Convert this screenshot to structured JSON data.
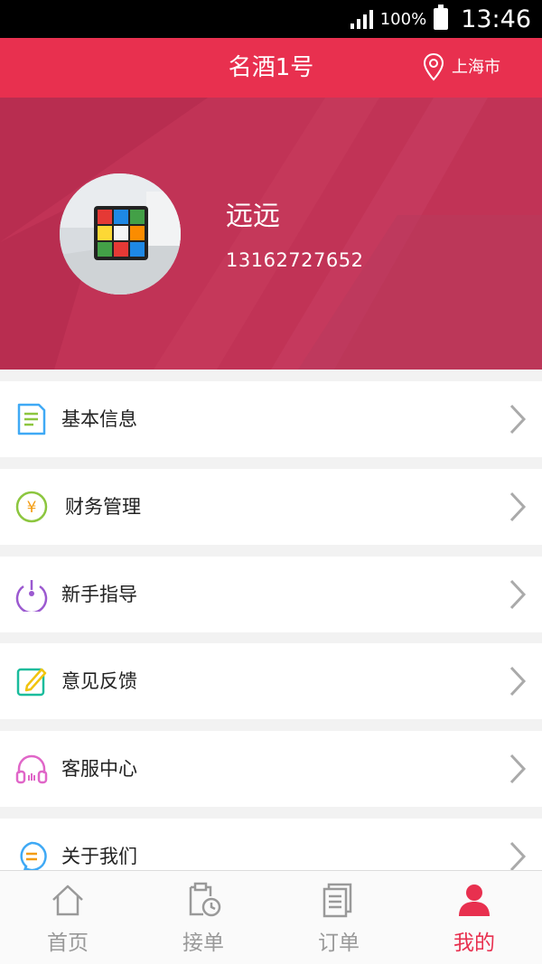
{
  "status_bar": {
    "battery": "100%",
    "time": "13:46"
  },
  "app_bar": {
    "title": "名酒1号",
    "city": "上海市"
  },
  "profile": {
    "name": "远远",
    "phone": "13162727652"
  },
  "menu": [
    {
      "label": "基本信息",
      "icon": "document-icon",
      "color": "#3fa9f5"
    },
    {
      "label": "财务管理",
      "icon": "yen-icon",
      "color": "#8cc63f"
    },
    {
      "label": "新手指导",
      "icon": "mouse-icon",
      "color": "#9b59d0"
    },
    {
      "label": "意见反馈",
      "icon": "edit-icon",
      "color": "#1abc9c"
    },
    {
      "label": "客服中心",
      "icon": "headphones-icon",
      "color": "#e066c8"
    },
    {
      "label": "关于我们",
      "icon": "chat-bubble-icon",
      "color": "#3fa9f5"
    }
  ],
  "bottom_nav": [
    {
      "label": "首页",
      "icon": "home-icon",
      "active": false
    },
    {
      "label": "接单",
      "icon": "clipboard-clock-icon",
      "active": false
    },
    {
      "label": "订单",
      "icon": "orders-icon",
      "active": false
    },
    {
      "label": "我的",
      "icon": "user-icon",
      "active": true
    }
  ],
  "colors": {
    "accent": "#e8304f",
    "header_bg": "#c13356",
    "inactive": "#999999"
  }
}
